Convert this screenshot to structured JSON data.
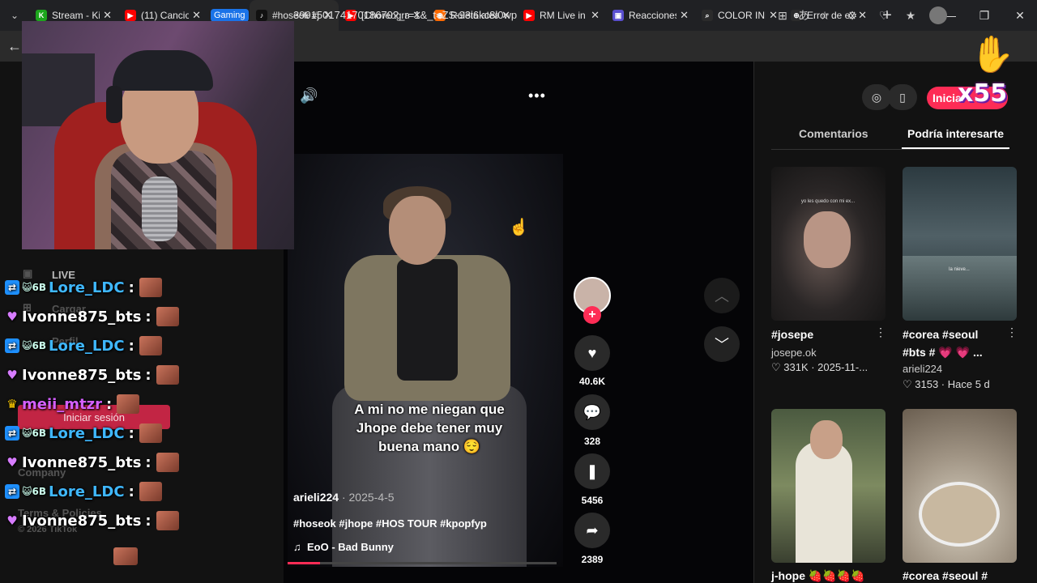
{
  "browser": {
    "tabs": [
      {
        "title": "Stream - Ki",
        "color": "#1ca61c",
        "glyph": "K"
      },
      {
        "title": "(11) Cancio",
        "color": "#ff0000",
        "glyph": "▶"
      },
      {
        "title": "Gaming",
        "group": true
      },
      {
        "title": "#hoseok #j",
        "color": "#111111",
        "glyph": "♪",
        "active": true
      },
      {
        "title": "[Choreogra",
        "color": "#ff0000",
        "glyph": "▶"
      },
      {
        "title": "Ruleta alea",
        "color": "#ff6a00",
        "glyph": "◉"
      },
      {
        "title": "RM Live in",
        "color": "#ff0000",
        "glyph": "▶"
      },
      {
        "title": "Reacciones",
        "color": "#5a4fcf",
        "glyph": "▣"
      },
      {
        "title": "COLOR IND",
        "color": "#2b2b2b",
        "glyph": "⌕"
      },
      {
        "title": "Error de ex",
        "color": "#2b2b2b",
        "glyph": "⊕"
      }
    ],
    "url": "39915017417018670?_r=1&_t=ZS-93i6kc8l0wp"
  },
  "video": {
    "caption_line1": "A mi no me niegan que",
    "caption_line2": "Jhope debe tener muy",
    "caption_line3": "buena mano 😌",
    "author": "arieli224",
    "date": "2025-4-5",
    "hashtags": "#hoseok #jhope #HOS TOUR #kpopfyp",
    "music": "EoO - Bad Bunny",
    "progress": 0.12,
    "likes": "40.6K",
    "comments": "328",
    "saves": "5456",
    "shares": "2389"
  },
  "panel": {
    "login_label": "Inicia",
    "tab_comments": "Comentarios",
    "tab_interest": "Podría interesarte",
    "thumbs": [
      {
        "title": "#josepe",
        "user": "josepe.ok",
        "stats": "♡ 331K · 2025-11-...",
        "overlay": "yo les quedo con mi ex..."
      },
      {
        "title": "#corea #seoul #bts # 💗 💗 ...",
        "user": "arieli224",
        "stats": "♡ 3153 · Hace 5 d",
        "overlay": "la nieve..."
      },
      {
        "title": "j-hope 🍓🍓🍓🍓",
        "user": "",
        "stats": ""
      },
      {
        "title": "#corea #seoul #",
        "user": "",
        "stats": ""
      }
    ]
  },
  "chat": {
    "messages": [
      {
        "user": "Lore_LDC",
        "color": "#3fb8ff",
        "badge": "sub",
        "extra": "😺6B"
      },
      {
        "user": "Ivonne875_bts",
        "color": "#ffffff",
        "badge": "heart",
        "extra": ""
      },
      {
        "user": "Lore_LDC",
        "color": "#3fb8ff",
        "badge": "sub",
        "extra": "😺6B"
      },
      {
        "user": "Ivonne875_bts",
        "color": "#ffffff",
        "badge": "heart",
        "extra": ""
      },
      {
        "user": "meii_mtzr",
        "color": "#d560ff",
        "badge": "crown",
        "extra": ""
      },
      {
        "user": "Lore_LDC",
        "color": "#3fb8ff",
        "badge": "sub",
        "extra": "😺6B"
      },
      {
        "user": "Ivonne875_bts",
        "color": "#ffffff",
        "badge": "heart",
        "extra": ""
      },
      {
        "user": "Lore_LDC",
        "color": "#3fb8ff",
        "badge": "sub",
        "extra": "😺6B"
      },
      {
        "user": "Ivonne875_bts",
        "color": "#ffffff",
        "badge": "heart",
        "extra": ""
      }
    ]
  },
  "ghost_sidebar": {
    "live": "LIVE",
    "upload": "Cargar",
    "profile": "Perfil",
    "login": "Iniciar sesión",
    "company": "Company",
    "terms": "Terms & Policies",
    "copyright": "© 2026 TikTok"
  },
  "hype": {
    "count": "x55"
  }
}
